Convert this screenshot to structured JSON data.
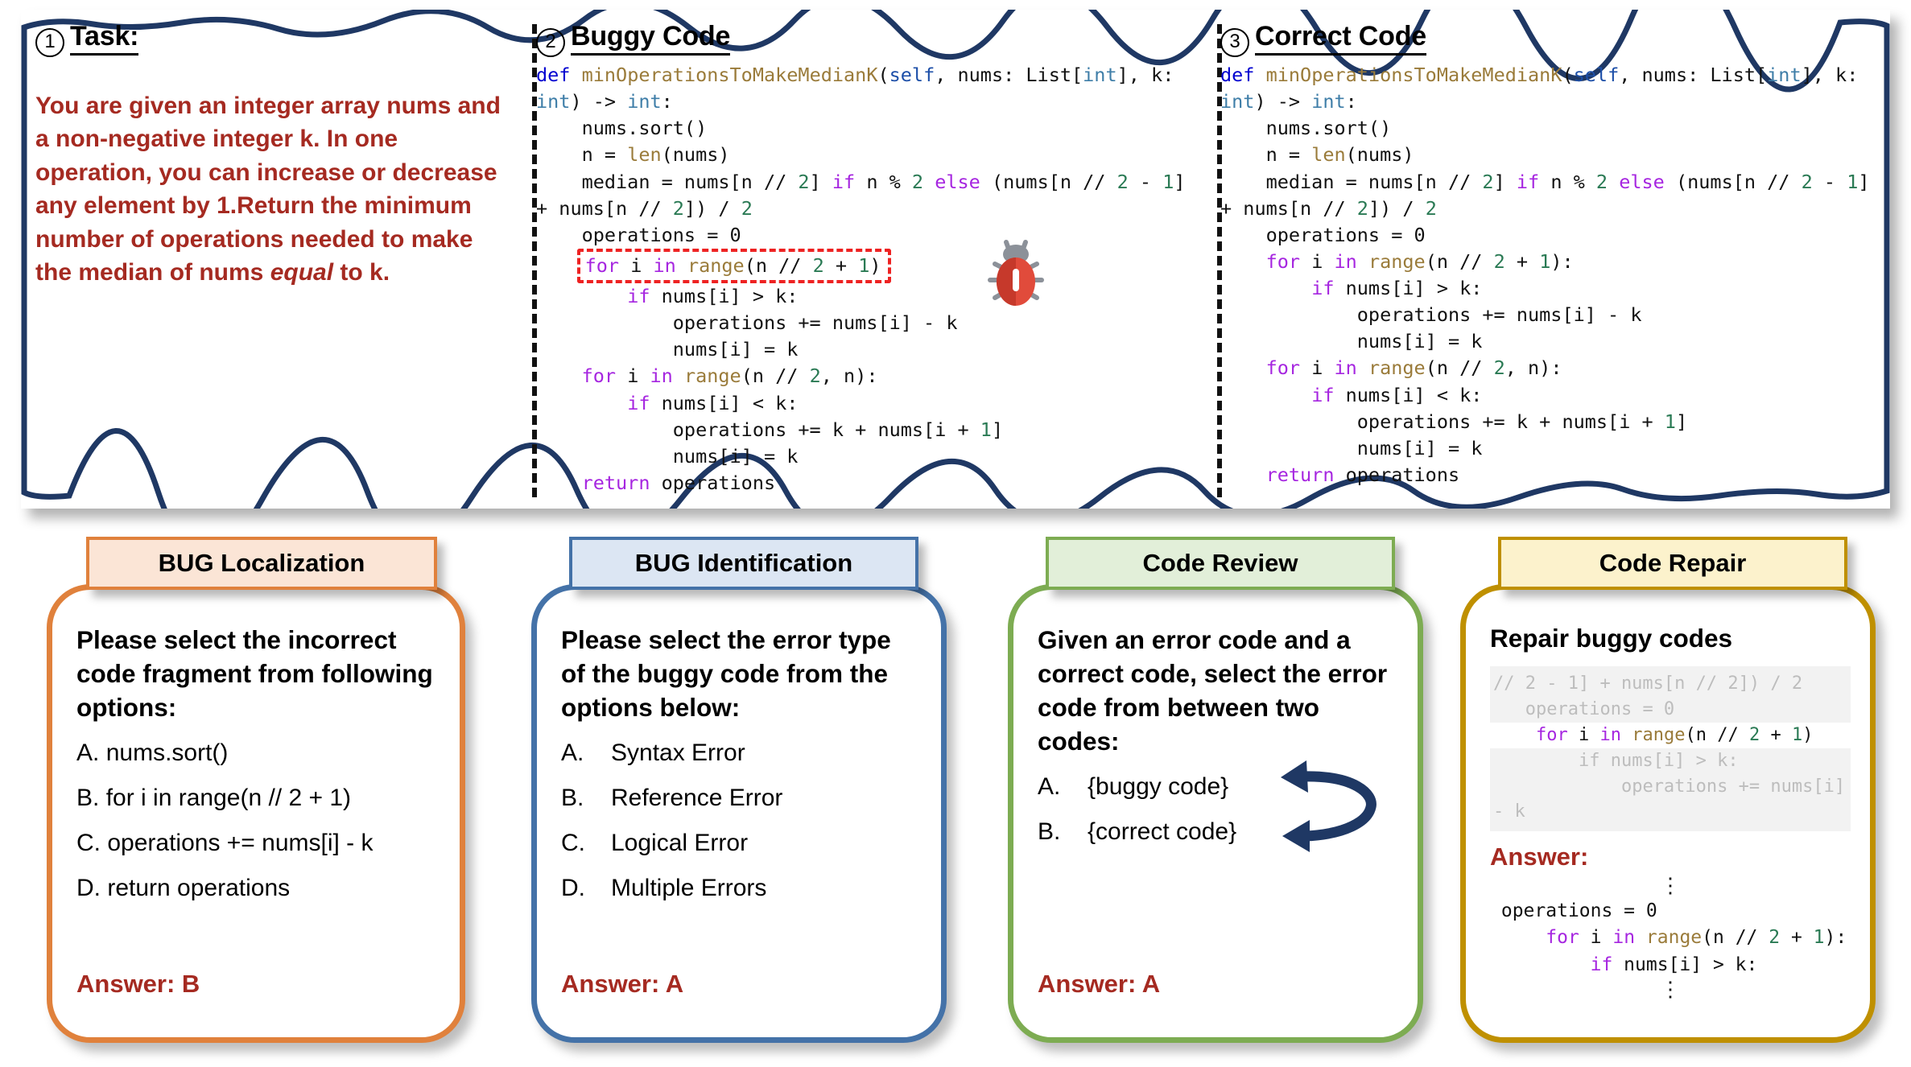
{
  "top_panel": {
    "sections": [
      {
        "marker": "1",
        "title": "Task:"
      },
      {
        "marker": "2",
        "title": "Buggy Code"
      },
      {
        "marker": "3",
        "title": "Correct Code"
      }
    ],
    "task_text_lines": [
      "You are given an integer array nums and a non-negative integer k. In one operation, you can increase or decrease any element by 1.Return the minimum number of operations needed to make the median of nums ",
      "equal",
      " to k."
    ],
    "task_text_plain": "You are given an integer array nums and a non-negative integer k. In one operation, you can increase or decrease any element by 1.Return the minimum number of operations needed to make the median of nums equal to k.",
    "buggy_code": {
      "signature_def": "def",
      "signature_name": "minOperationsToMakeMedianK",
      "line_sort": "nums.sort()",
      "line_n": "n = len(nums)",
      "line_median": "median = nums[n // 2] if n % 2 else (nums[n // 2 - 1] + nums[n // 2]) / 2",
      "line_ops_init": "operations = 0",
      "buggy_line": "for i in range(n // 2 + 1)",
      "line_if_gt": "if nums[i] > k:",
      "line_add_sub": "operations += nums[i] - k",
      "line_assign_k1": "nums[i] = k",
      "line_for2": "for i in range(n // 2, n):",
      "line_if_lt": "if nums[i] < k:",
      "line_add_plus": "operations += k + nums[i + 1]",
      "line_assign_k2": "nums[i] = k",
      "line_return": "return operations",
      "bug_marker_icon": "bug-icon"
    },
    "correct_code": {
      "signature_def": "def",
      "signature_name": "minOperationsToMakeMedianK",
      "line_sort": "nums.sort()",
      "line_n": "n = len(nums)",
      "line_median": "median = nums[n // 2] if n % 2 else (nums[n // 2 - 1] + nums[n // 2]) / 2",
      "line_ops_init": "operations = 0",
      "fixed_line": "for i in range(n // 2 + 1):",
      "line_if_gt": "if nums[i] > k:",
      "line_add_sub": "operations += nums[i] - k",
      "line_assign_k1": "nums[i] = k",
      "line_for2": "for i in range(n // 2, n):",
      "line_if_lt": "if nums[i] < k:",
      "line_add_plus": "operations += k + nums[i + 1]",
      "line_assign_k2": "nums[i] = k",
      "line_return": "return operations"
    }
  },
  "cards": {
    "bug_localization": {
      "header": "BUG Localization",
      "question": "Please select the incorrect code fragment from following options:",
      "options": [
        {
          "label": "A.",
          "text": "nums.sort()"
        },
        {
          "label": "B.",
          "text": "for i in range(n // 2 + 1)"
        },
        {
          "label": "C.",
          "text": "operations += nums[i] - k"
        },
        {
          "label": "D.",
          "text": "return operations"
        }
      ],
      "answer": "Answer: B",
      "accent": "#E0813C",
      "header_fill": "#FBE5D6"
    },
    "bug_identification": {
      "header": "BUG Identification",
      "question": "Please select the error type of the buggy code from the options below:",
      "options": [
        {
          "label": "A.",
          "text": "Syntax Error"
        },
        {
          "label": "B.",
          "text": "Reference Error"
        },
        {
          "label": "C.",
          "text": "Logical Error"
        },
        {
          "label": "D.",
          "text": "Multiple Errors"
        }
      ],
      "answer": "Answer: A",
      "accent": "#4472A8",
      "header_fill": "#DCE6F3"
    },
    "code_review": {
      "header": "Code Review",
      "question": "Given an error code and a correct code, select the error code from between two codes:",
      "options": [
        {
          "label": "A.",
          "text": "{buggy code}"
        },
        {
          "label": "B.",
          "text": "{correct code}"
        }
      ],
      "answer": "Answer: A",
      "accent": "#7DAC52",
      "header_fill": "#E2EFD9",
      "arrow_icon": "swap-curved-arrow-icon"
    },
    "code_repair": {
      "header": "Code Repair",
      "title": "Repair buggy codes",
      "faded_code": {
        "line1": "// 2 - 1] + nums[n // 2]) / 2",
        "line2": "   operations = 0",
        "highlight_line": "    for i in range(n // 2 + 1)",
        "line4": "        if nums[i] > k:",
        "line5": "            operations += nums[i] - k"
      },
      "answer_label": "Answer:",
      "answer_code": {
        "dots_top": "⋮",
        "line1": " operations = 0",
        "line2": "     for i in range(n // 2 + 1):",
        "line3": "         if nums[i] > k:",
        "dots_bottom": "⋮"
      },
      "accent": "#BF9000",
      "header_fill": "#FCF2CC"
    }
  },
  "colors": {
    "panel_border": "#1F3864",
    "answer_red": "#a52a21",
    "task_red": "#a52a21",
    "bug_highlight": "#ee2222",
    "arrow_navy": "#1F3864"
  }
}
